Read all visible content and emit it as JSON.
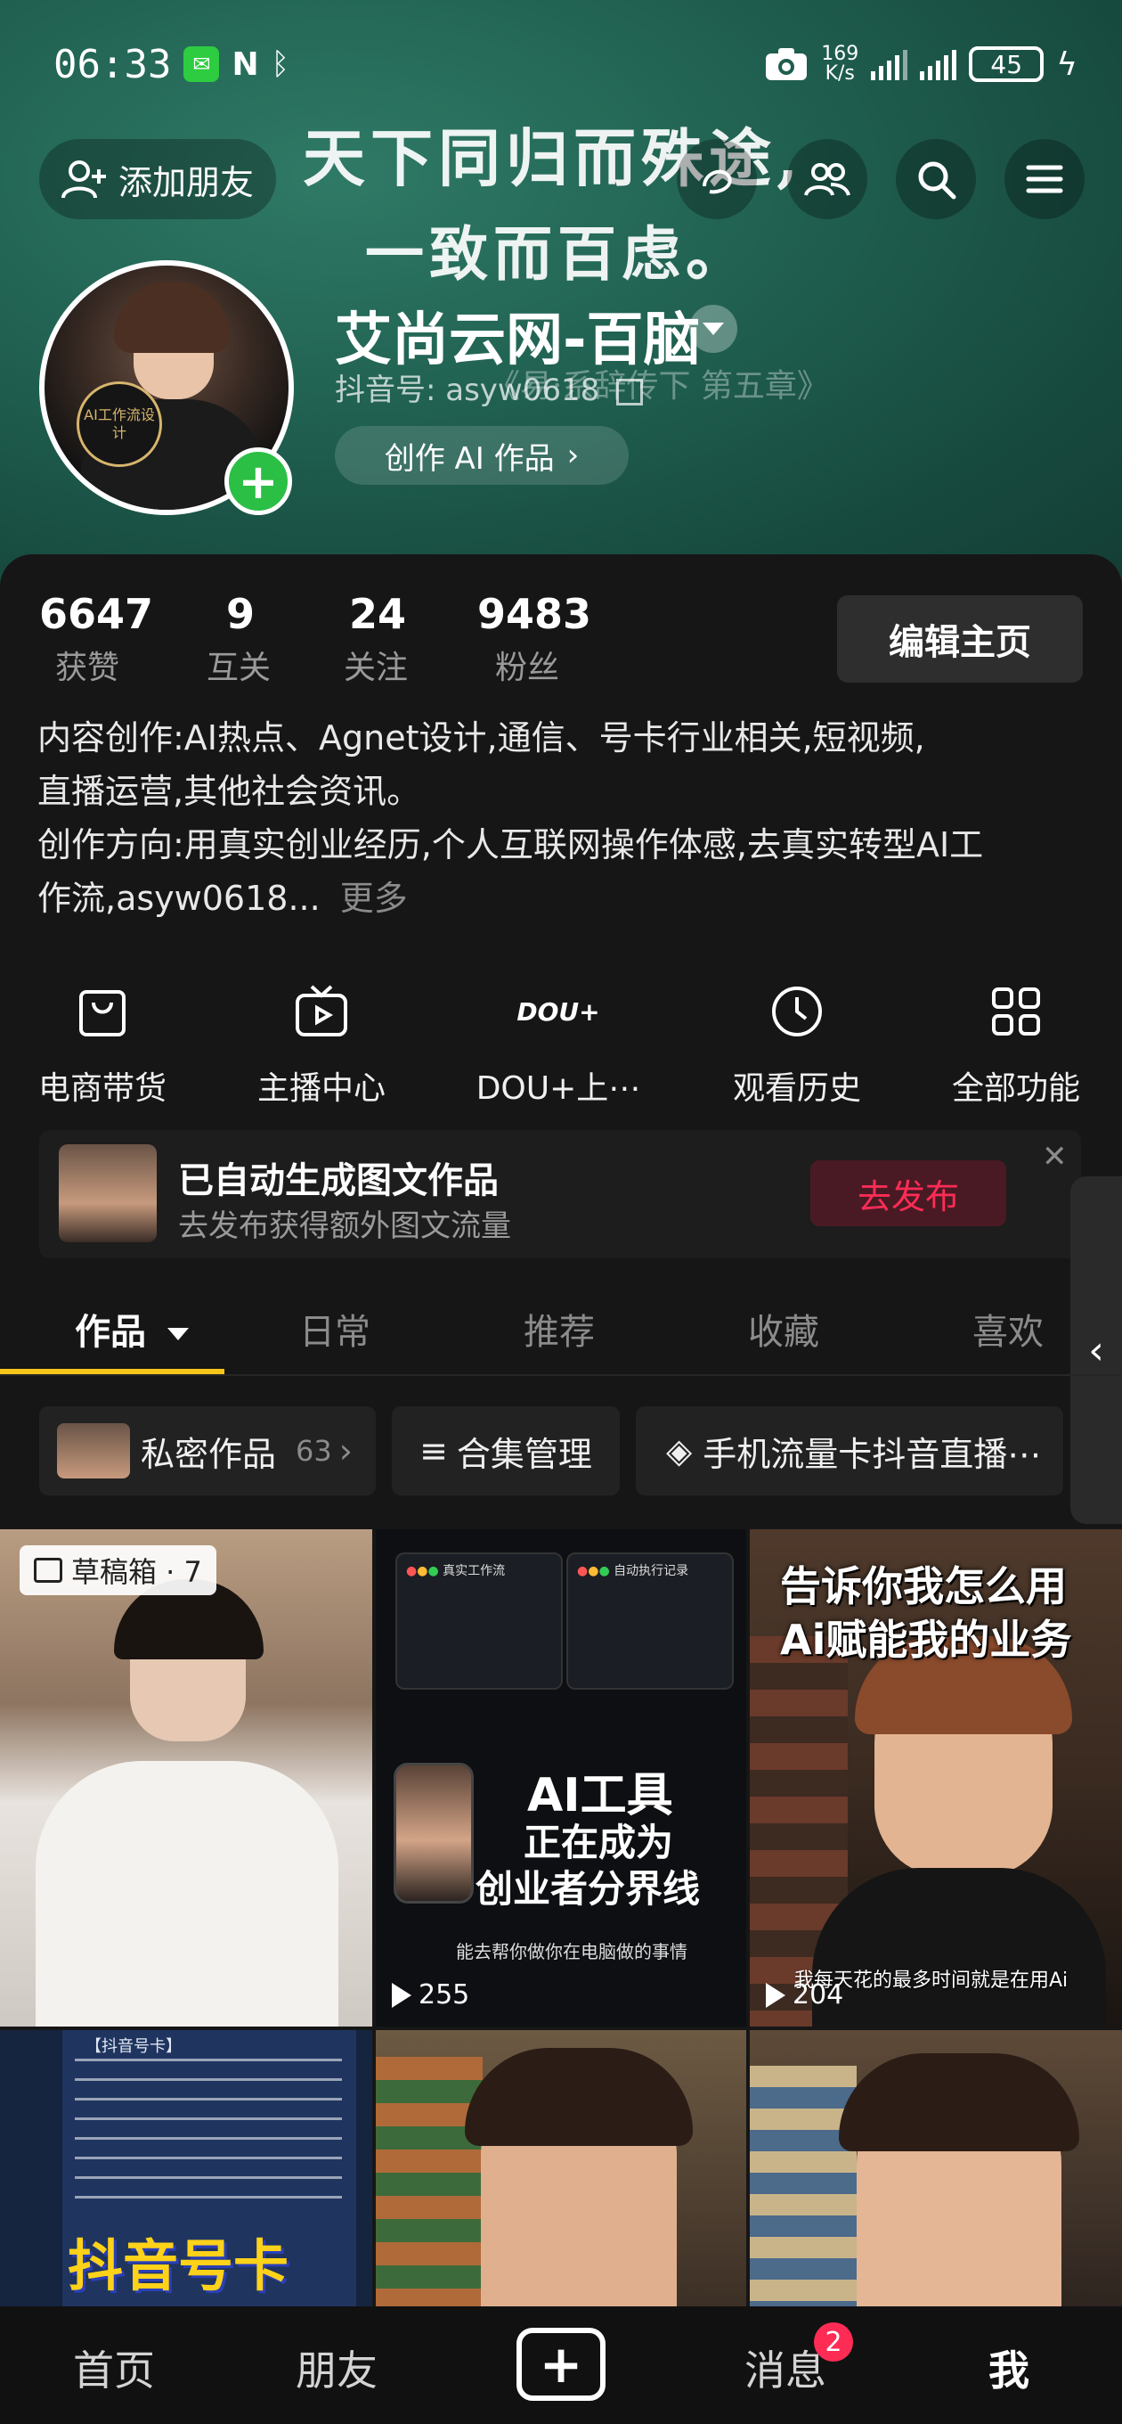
{
  "status_bar": {
    "time": "06:33",
    "speed_top": "169",
    "speed_bottom": "K/s",
    "battery": "45"
  },
  "header": {
    "add_friend_label": "添加朋友",
    "calligraphy_line1": "天下同归而殊途,",
    "calligraphy_line2": "一致而百虑。",
    "calligraphy_small": "《易·系辞传下 第五章》"
  },
  "profile": {
    "name": "艾尚云网-百脑",
    "douyin_id": "抖音号: asyw0618",
    "create_ai_label": "创作 AI 作品",
    "avatar_badge": "AI工作流设计"
  },
  "stats": [
    {
      "num": "6647",
      "label": "获赞"
    },
    {
      "num": "9",
      "label": "互关"
    },
    {
      "num": "24",
      "label": "关注"
    },
    {
      "num": "9483",
      "label": "粉丝"
    }
  ],
  "edit_button": "编辑主页",
  "bio": {
    "line1": "内容创作:AI热点、Agnet设计,通信、号卡行业相关,短视频,",
    "line2": "直播运营,其他社会资讯。",
    "line3": "创作方向:用真实创业经历,个人互联网操作体感,去真实转型AI工",
    "line4": "作流,asyw0618...",
    "more": "更多"
  },
  "functions": [
    {
      "label": "电商带货",
      "icon": "shopping-bag-icon"
    },
    {
      "label": "主播中心",
      "icon": "tv-play-icon"
    },
    {
      "label": "DOU+上⋯",
      "icon": "dou-plus-icon",
      "icon_text": "DOU+"
    },
    {
      "label": "观看历史",
      "icon": "clock-icon"
    },
    {
      "label": "全部功能",
      "icon": "grid-icon"
    }
  ],
  "notice": {
    "title": "已自动生成图文作品",
    "subtitle": "去发布获得额外图文流量",
    "button": "去发布"
  },
  "tabs": {
    "works": "作品",
    "daily": "日常",
    "recommend": "推荐",
    "favorites": "收藏",
    "likes": "喜欢"
  },
  "chips": {
    "private_label": "私密作品",
    "private_count": "63",
    "collection_label": "合集管理",
    "topic_label": "手机流量卡抖音直播⋯"
  },
  "grid": {
    "draft_label": "草稿箱 · 7",
    "v2_window_left": "真实工作流",
    "v2_window_right": "自动执行记录",
    "v2_title1": "AI工具",
    "v2_title2": "正在成为",
    "v2_title3": "创业者分界线",
    "v2_caption": "能去帮你做你在电脑做的事情",
    "v2_plays": "255",
    "v3_title1": "告诉你我怎么用",
    "v3_title2": "Ai赋能我的业务",
    "v3_caption": "我每天花的最多时间就是在用Ai",
    "v3_plays": "204",
    "v4_heading": "【抖音号卡】",
    "v4_big": "抖音号卡"
  },
  "bottom_nav": {
    "home": "首页",
    "friends": "朋友",
    "messages": "消息",
    "messages_badge": "2",
    "me": "我"
  },
  "colors": {
    "header_green": "#1f5e4f",
    "accent_red": "#fe2c55",
    "tab_underline": "#f5c518",
    "plus_green": "#2bbf45"
  }
}
